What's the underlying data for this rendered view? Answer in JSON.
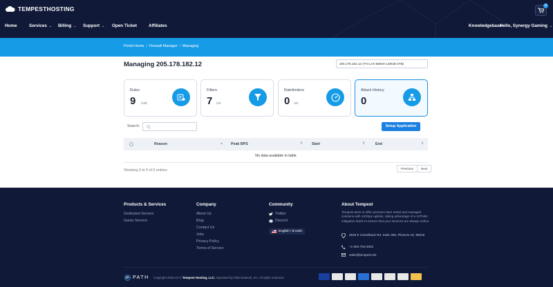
{
  "header": {
    "brand": "TEMPESTHOSTING",
    "cart_count": "0",
    "nav": {
      "home": "Home",
      "services": "Services",
      "billing": "Billing",
      "support": "Support",
      "open_ticket": "Open Ticket",
      "affiliates": "Affiliates",
      "knowledgebase": "Knowledgebase",
      "user": "Hello, Synergy Gaming"
    }
  },
  "breadcrumb": {
    "home": "Portal Home",
    "firewall": "Firewall Manager",
    "current": "Managing"
  },
  "page_title": "Managing 205.178.182.12",
  "server_select": {
    "value": "205.178.182.12 (TH-LAX-5950X-128GB-2TB)"
  },
  "cards": [
    {
      "label": "Rules",
      "value": "9",
      "max": "/100",
      "icon": "rules-icon"
    },
    {
      "label": "Filters",
      "value": "7",
      "max": "/20",
      "icon": "funnel-icon"
    },
    {
      "label": "Ratelimiters",
      "value": "0",
      "max": "/20",
      "icon": "gauge-icon"
    },
    {
      "label": "Attack History",
      "value": "0",
      "max": "",
      "icon": "network-icon"
    }
  ],
  "search": {
    "label": "Search:",
    "placeholder": ""
  },
  "setup_button": "Setup Application",
  "table": {
    "columns": [
      "Reason",
      "Peak BPS",
      "Start",
      "End"
    ],
    "empty_text": "No data available in table",
    "showing": "Showing 0 to 0 of 0 entries",
    "pager": {
      "previous": "Previous",
      "next": "Next"
    }
  },
  "footer": {
    "products": {
      "heading": "Products & Services",
      "links": [
        "Dedicated Servers",
        "Game Servers"
      ]
    },
    "company": {
      "heading": "Company",
      "links": [
        "About Us",
        "Blog",
        "Contact Us",
        "Jobs",
        "Privacy Policy",
        "Terms of Service"
      ]
    },
    "community": {
      "heading": "Community",
      "twitter": "Twitter",
      "discord": "Discord",
      "language": "English / $ USD"
    },
    "about": {
      "heading": "About Tempest",
      "text": "Tempest aims to offer premium bare metal and managed solutions with 10Gbps uplinks, taking advantage of a 10Tbit/s mitigation stack to ensure that your services are always online.",
      "address": "2525 E Camelback Rd. Suite 460, Phoenix AZ, 85016",
      "phone": "+1 602-704-2002",
      "email": "sales@tempest.net"
    },
    "path_logo": "PATH",
    "copyright_pre": "Copyright 2020-22 ©",
    "copyright_company": "Tempest Hosting, LLC.",
    "copyright_post": "Operated by Path Network, Inc. All rights reserved.",
    "payments": [
      {
        "name": "VISA",
        "color": "#1a3fa0"
      },
      {
        "name": "discover",
        "color": "#e8e8e8"
      },
      {
        "name": "PayPal",
        "color": "#e8e8e8"
      },
      {
        "name": "amex",
        "color": "#2a6fd6"
      },
      {
        "name": "bank",
        "color": "#e8e8e8"
      },
      {
        "name": "mastercard",
        "color": "#e8e8e8"
      },
      {
        "name": "alipay",
        "color": "#e8e8e8"
      },
      {
        "name": "bitcoin",
        "color": "#f2c14e"
      }
    ]
  }
}
